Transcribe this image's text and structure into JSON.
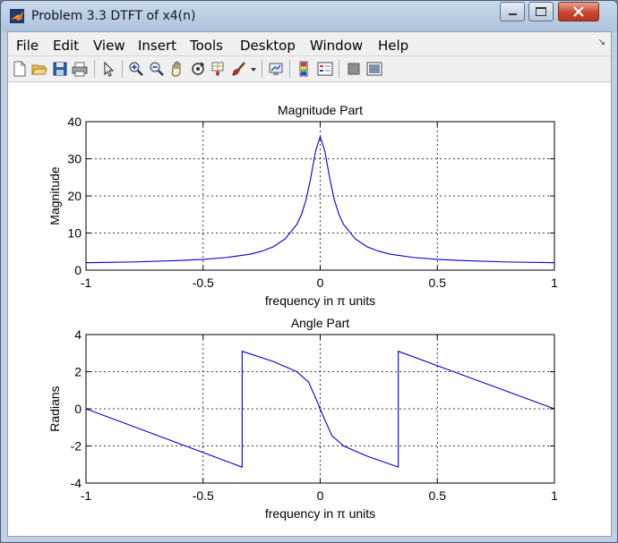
{
  "window": {
    "title": "Problem 3.3 DTFT of x4(n)"
  },
  "menu": [
    "File",
    "Edit",
    "View",
    "Insert",
    "Tools",
    "Desktop",
    "Window",
    "Help"
  ],
  "toolbar": {
    "icons": [
      "new-figure-icon",
      "open-file-icon",
      "save-icon",
      "print-icon",
      "edit-plot-arrow-icon",
      "zoom-in-icon",
      "zoom-out-icon",
      "pan-hand-icon",
      "rotate-3d-icon",
      "data-cursor-icon",
      "brush-icon",
      "brush-dropdown-icon",
      "link-plot-icon",
      "insert-colorbar-icon",
      "insert-legend-icon",
      "hide-plot-tools-icon",
      "show-plot-tools-icon"
    ]
  },
  "chart_data": [
    {
      "type": "line",
      "title": "Magnitude Part",
      "xlabel": "frequency in π units",
      "ylabel": "Magnitude",
      "xlim": [
        -1,
        1
      ],
      "ylim": [
        0,
        40
      ],
      "xticks": [
        "-1",
        "-0.5",
        "0",
        "0.5",
        "1"
      ],
      "yticks": [
        "0",
        "10",
        "20",
        "30",
        "40"
      ],
      "grid": true,
      "color": "#0000cc",
      "x": [
        -1.0,
        -0.8,
        -0.6,
        -0.5,
        -0.4,
        -0.3,
        -0.25,
        -0.2,
        -0.15,
        -0.1,
        -0.08,
        -0.06,
        -0.04,
        -0.02,
        0.0,
        0.02,
        0.04,
        0.06,
        0.08,
        0.1,
        0.15,
        0.2,
        0.25,
        0.3,
        0.4,
        0.5,
        0.6,
        0.8,
        1.0
      ],
      "y": [
        2.0,
        2.2,
        2.6,
        2.9,
        3.4,
        4.3,
        5.1,
        6.3,
        8.4,
        12.3,
        15.0,
        19.0,
        25.0,
        32.0,
        36.0,
        32.0,
        25.0,
        19.0,
        15.0,
        12.3,
        8.4,
        6.3,
        5.1,
        4.3,
        3.4,
        2.9,
        2.6,
        2.2,
        2.0
      ]
    },
    {
      "type": "line",
      "title": "Angle Part",
      "xlabel": "frequency in π units",
      "ylabel": "Radians",
      "xlim": [
        -1,
        1
      ],
      "ylim": [
        -4,
        4
      ],
      "xticks": [
        "-1",
        "-0.5",
        "0",
        "0.5",
        "1"
      ],
      "yticks": [
        "-4",
        "-2",
        "0",
        "2",
        "4"
      ],
      "grid": true,
      "color": "#0000cc",
      "x": [
        -1.0,
        -0.3333,
        -0.3333,
        -0.2,
        -0.1,
        -0.05,
        -0.02,
        0.0,
        0.02,
        0.05,
        0.1,
        0.2,
        0.3333,
        0.3333,
        1.0
      ],
      "y": [
        0.0,
        -3.14,
        3.1,
        2.55,
        2.0,
        1.45,
        0.6,
        0.0,
        -0.6,
        -1.45,
        -2.0,
        -2.55,
        -3.14,
        3.1,
        0.0
      ]
    }
  ]
}
